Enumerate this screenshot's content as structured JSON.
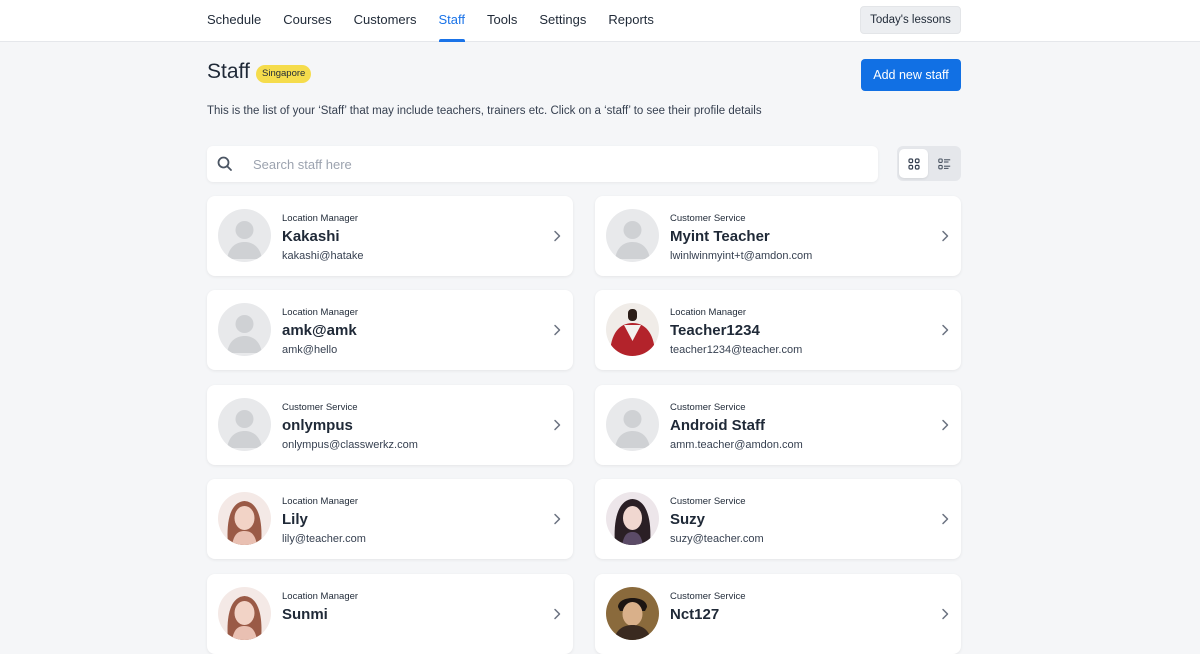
{
  "nav": {
    "items": [
      {
        "label": "Schedule",
        "active": false
      },
      {
        "label": "Courses",
        "active": false
      },
      {
        "label": "Customers",
        "active": false
      },
      {
        "label": "Staff",
        "active": true
      },
      {
        "label": "Tools",
        "active": false
      },
      {
        "label": "Settings",
        "active": false
      },
      {
        "label": "Reports",
        "active": false
      }
    ],
    "today_label": "Today's lessons"
  },
  "header": {
    "title": "Staff",
    "location_badge": "Singapore",
    "add_button": "Add new staff",
    "description": "This is the list of your ‘Staff’ that may include teachers, trainers etc. Click on a ‘staff’ to see their profile details"
  },
  "search": {
    "placeholder": "Search staff here",
    "value": ""
  },
  "view": {
    "selected": "grid"
  },
  "colors": {
    "accent": "#1170e4",
    "badge": "#f5dc4c",
    "background": "#f5f6f8"
  },
  "staff": [
    {
      "role": "Location Manager",
      "name": "Kakashi",
      "email": "kakashi@hatake",
      "avatar": "default"
    },
    {
      "role": "Customer Service",
      "name": "Myint Teacher",
      "email": "lwinlwinmyint+t@amdon.com",
      "avatar": "default"
    },
    {
      "role": "Location Manager",
      "name": "amk@amk",
      "email": "amk@hello",
      "avatar": "default"
    },
    {
      "role": "Location Manager",
      "name": "Teacher1234",
      "email": "teacher1234@teacher.com",
      "avatar": "photo-red"
    },
    {
      "role": "Customer Service",
      "name": "onlympus",
      "email": "onlympus@classwerkz.com",
      "avatar": "default"
    },
    {
      "role": "Customer Service",
      "name": "Android Staff",
      "email": "amm.teacher@amdon.com",
      "avatar": "default"
    },
    {
      "role": "Location Manager",
      "name": "Lily",
      "email": "lily@teacher.com",
      "avatar": "photo-woman-light"
    },
    {
      "role": "Customer Service",
      "name": "Suzy",
      "email": "suzy@teacher.com",
      "avatar": "photo-woman-dark"
    },
    {
      "role": "Location Manager",
      "name": "Sunmi",
      "email": "",
      "avatar": "photo-woman-light"
    },
    {
      "role": "Customer Service",
      "name": "Nct127",
      "email": "",
      "avatar": "photo-man"
    }
  ]
}
